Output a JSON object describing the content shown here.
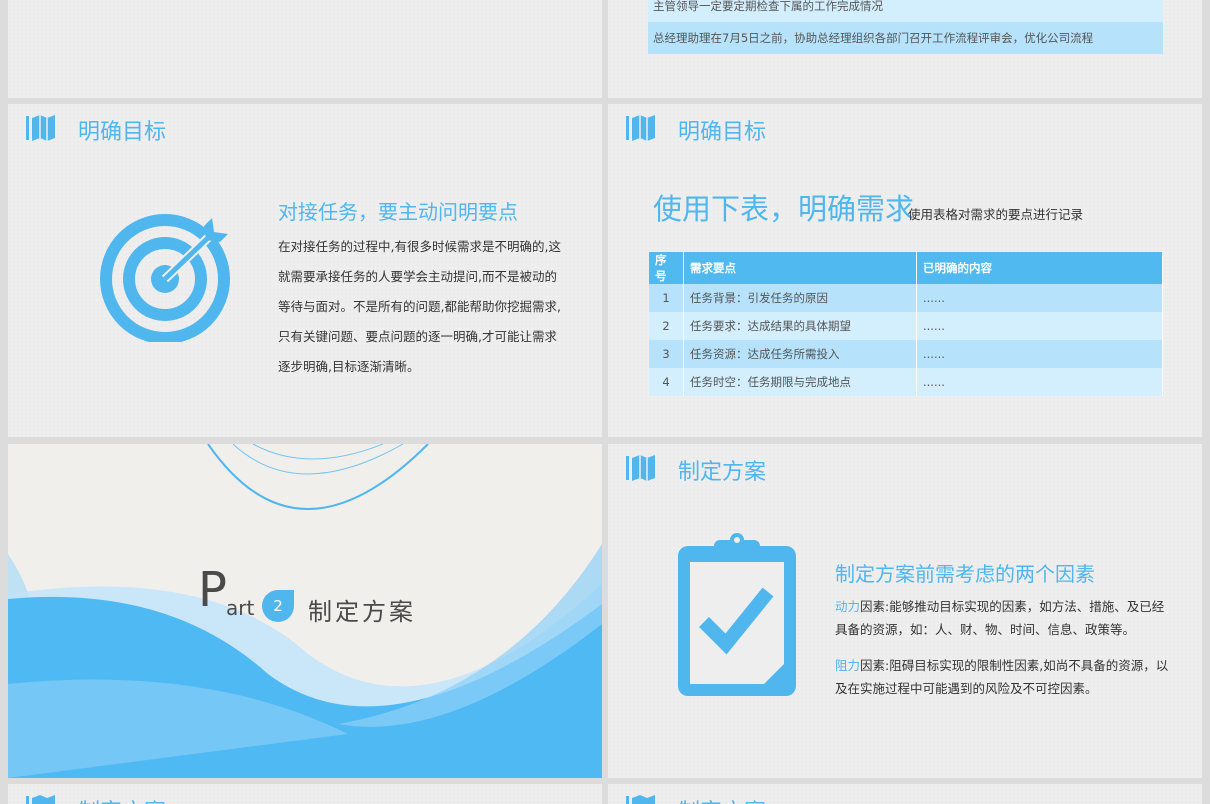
{
  "top_right": {
    "rows": [
      "主管领导一定要定期检查下属的工作完成情况",
      "总经理助理在7月5日之前，协助总经理组织各部门召开工作流程评审会，优化公司流程"
    ]
  },
  "section_clarify": {
    "title": "明确目标"
  },
  "target_slide": {
    "heading": "对接任务，要主动问明要点",
    "body": "在对接任务的过程中,有很多时候需求是不明确的,这就需要承接任务的人要学会主动提问,而不是被动的等待与面对。不是所有的问题,都能帮助你挖掘需求,只有关键问题、要点问题的逐一明确,才可能让需求逐步明确,目标逐渐清晰。"
  },
  "table_slide": {
    "big_title": "使用下表，明确需求",
    "subtitle": "使用表格对需求的要点进行记录",
    "headers": [
      "序号",
      "需求要点",
      "已明确的内容"
    ],
    "rows": [
      [
        "1",
        "任务背景：引发任务的原因",
        "......"
      ],
      [
        "2",
        "任务要求：达成结果的具体期望",
        "......"
      ],
      [
        "3",
        "任务资源：达成任务所需投入",
        "......"
      ],
      [
        "4",
        "任务时空：任务期限与完成地点",
        "......"
      ]
    ]
  },
  "part_slide": {
    "p": "P",
    "art": "art",
    "number": "2",
    "title": "制定方案"
  },
  "plan_slide": {
    "title": "制定方案",
    "heading": "制定方案前需考虑的两个因素",
    "factor1_key": "动力",
    "factor1_text": "因素:能够推动目标实现的因素，如方法、措施、及已经具备的资源，如：人、财、物、时间、信息、政策等。",
    "factor2_key": "阻力",
    "factor2_text": "因素:阻碍目标实现的限制性因素,如尚不具备的资源，以及在实施过程中可能遇到的风险及不可控因素。"
  },
  "next_slides": {
    "left_title": "制定方案",
    "right_title": "制定方案"
  },
  "colors": {
    "accent": "#4fb6ee",
    "text": "#333333"
  },
  "icons": [
    "map-icon",
    "target-icon",
    "clipboard-check-icon"
  ]
}
